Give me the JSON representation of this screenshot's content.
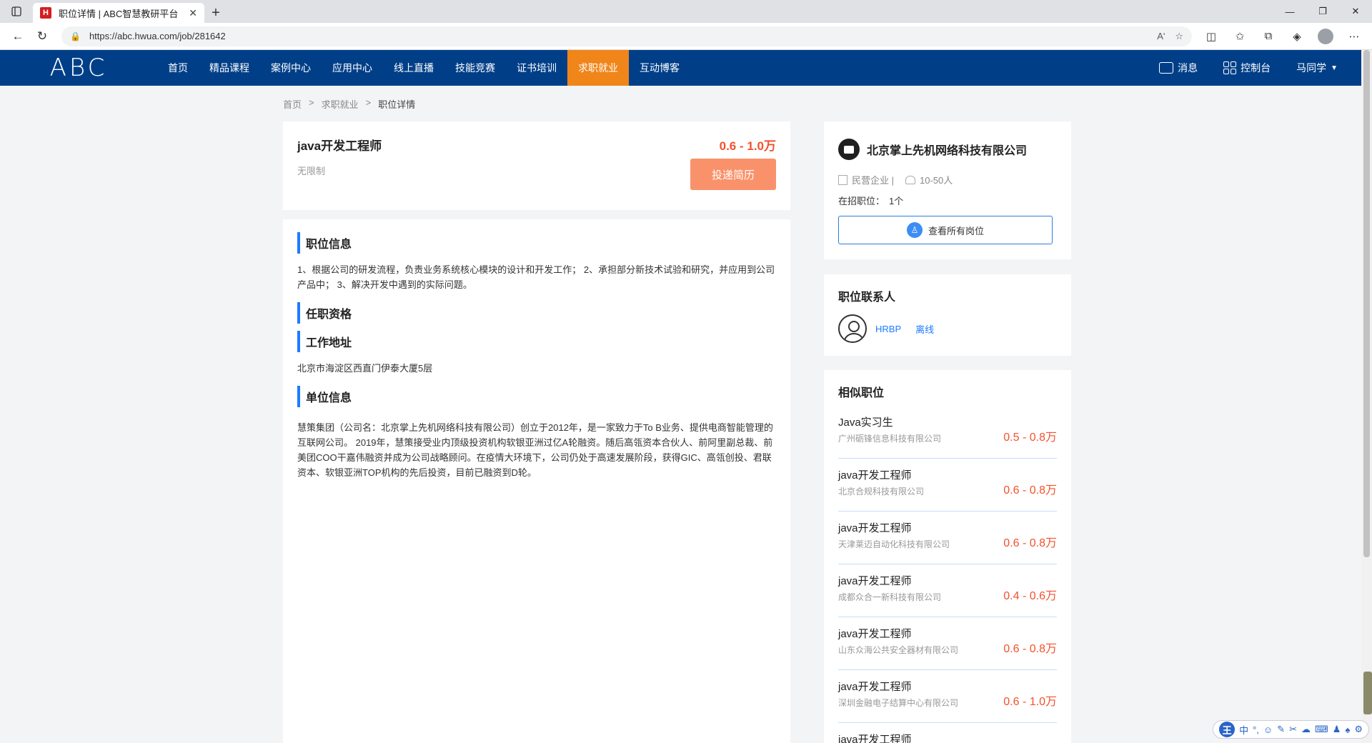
{
  "browser": {
    "tab_title": "职位详情 | ABC智慧教研平台",
    "favicon_letter": "H",
    "url": "https://abc.hwua.com/job/281642",
    "reader_label": "Aʹ"
  },
  "site": {
    "logo_text": "ABC",
    "nav": [
      {
        "label": "首页"
      },
      {
        "label": "精品课程"
      },
      {
        "label": "案例中心"
      },
      {
        "label": "应用中心"
      },
      {
        "label": "线上直播"
      },
      {
        "label": "技能竞赛"
      },
      {
        "label": "证书培训"
      },
      {
        "label": "求职就业",
        "active": true
      },
      {
        "label": "互动博客"
      }
    ],
    "messages_label": "消息",
    "console_label": "控制台",
    "user_label": "马同学",
    "accent_color": "#f08519",
    "header_color": "#003f88"
  },
  "breadcrumb": {
    "home": "首页",
    "section": "求职就业",
    "current": "职位详情",
    "separator": ">"
  },
  "job": {
    "title": "java开发工程师",
    "requirement": "无限制",
    "salary": "0.6 - 1.0万",
    "apply_label": "投递简历",
    "sections": {
      "info_title": "职位信息",
      "info_text": "1、根据公司的研发流程，负责业务系统核心模块的设计和开发工作； 2、承担部分新技术试验和研究，并应用到公司产品中； 3、解决开发中遇到的实际问题。",
      "qual_title": "任职资格",
      "addr_title": "工作地址",
      "addr_text": "北京市海淀区西直门伊泰大厦5层",
      "unit_title": "单位信息",
      "unit_text": "慧策集团（公司名：北京掌上先机网络科技有限公司）创立于2012年，是一家致力于To B业务、提供电商智能管理的互联网公司。 2019年，慧策接受业内顶级投资机构软银亚洲过亿A轮融资。随后高瓴资本合伙人、前阿里副总裁、前美团COO干嘉伟融资并成为公司战略顾问。在疫情大环境下，公司仍处于高速发展阶段，获得GIC、高瓴创投、君联资本、软银亚洲TOP机构的先后投资，目前已融资到D轮。"
    }
  },
  "company": {
    "name": "北京掌上先机网络科技有限公司",
    "type": "民营企业 |",
    "size": "10-50人",
    "open_label": "在招职位：",
    "open_count": "1个",
    "view_all_label": "查看所有岗位"
  },
  "contact": {
    "title": "职位联系人",
    "name": "HRBP",
    "status": "离线"
  },
  "similar": {
    "title": "相似职位",
    "items": [
      {
        "title": "Java实习生",
        "company": "广州砺锋信息科技有限公司",
        "salary": "0.5 - 0.8万"
      },
      {
        "title": "java开发工程师",
        "company": "北京合规科技有限公司",
        "salary": "0.6 - 0.8万"
      },
      {
        "title": "java开发工程师",
        "company": "天津莱迈自动化科技有限公司",
        "salary": "0.6 - 0.8万"
      },
      {
        "title": "java开发工程师",
        "company": "成都众合一新科技有限公司",
        "salary": "0.4 - 0.6万"
      },
      {
        "title": "java开发工程师",
        "company": "山东众海公共安全器材有限公司",
        "salary": "0.6 - 0.8万"
      },
      {
        "title": "java开发工程师",
        "company": "深圳金融电子结算中心有限公司",
        "salary": "0.6 - 1.0万"
      },
      {
        "title": "java开发工程师",
        "company": "",
        "salary": ""
      }
    ]
  },
  "ime": {
    "logo": "王",
    "mode": "中",
    "punct": "°,"
  }
}
